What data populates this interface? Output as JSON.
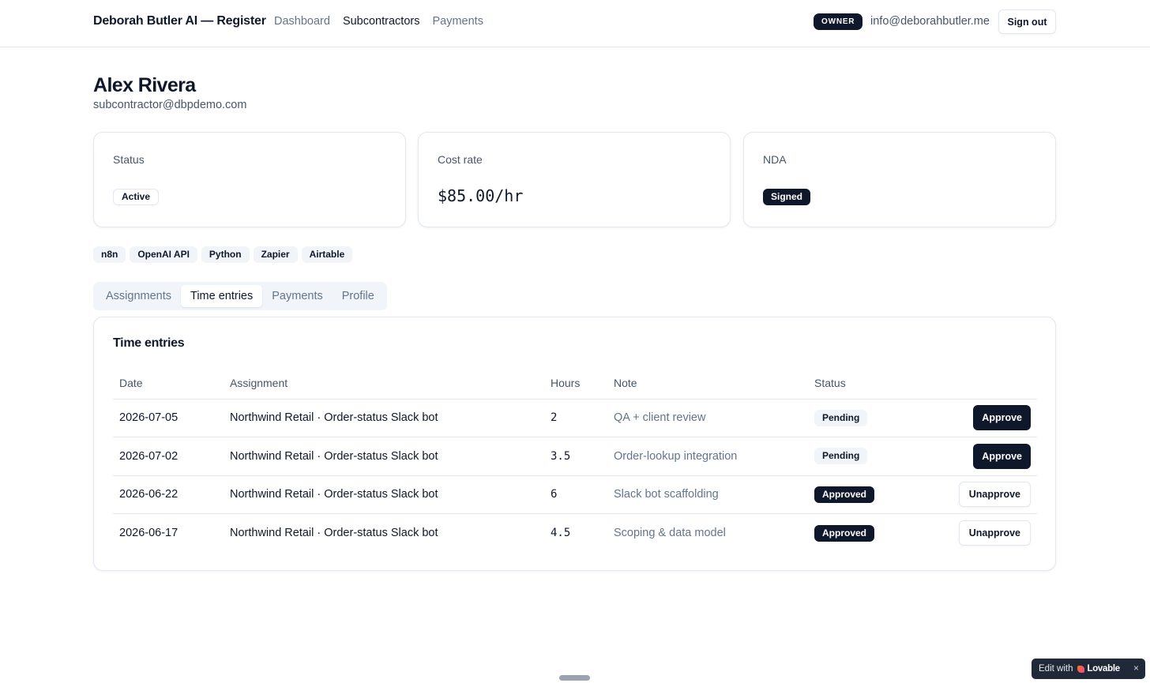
{
  "header": {
    "brand": "Deborah Butler AI — Register",
    "nav": [
      "Dashboard",
      "Subcontractors",
      "Payments"
    ],
    "active_nav": "Subcontractors",
    "role": "OWNER",
    "user_email": "info@deborahbutler.me",
    "signout_label": "Sign out"
  },
  "profile": {
    "name": "Alex Rivera",
    "email": "subcontractor@dbpdemo.com"
  },
  "cards": {
    "status": {
      "label": "Status",
      "value": "Active"
    },
    "rate": {
      "label": "Cost rate",
      "value": "$85.00/hr"
    },
    "nda": {
      "label": "NDA",
      "value": "Signed"
    }
  },
  "skills": [
    "n8n",
    "OpenAI API",
    "Python",
    "Zapier",
    "Airtable"
  ],
  "tabs": [
    "Assignments",
    "Time entries",
    "Payments",
    "Profile"
  ],
  "active_tab": "Time entries",
  "time_entries": {
    "title": "Time entries",
    "columns": [
      "Date",
      "Assignment",
      "Hours",
      "Note",
      "Status"
    ],
    "rows": [
      {
        "date": "2026-07-05",
        "assignment": "Northwind Retail · Order-status Slack bot",
        "hours": "2",
        "note": "QA + client review",
        "status": "Pending",
        "action": "Approve"
      },
      {
        "date": "2026-07-02",
        "assignment": "Northwind Retail · Order-status Slack bot",
        "hours": "3.5",
        "note": "Order-lookup integration",
        "status": "Pending",
        "action": "Approve"
      },
      {
        "date": "2026-06-22",
        "assignment": "Northwind Retail · Order-status Slack bot",
        "hours": "6",
        "note": "Slack bot scaffolding",
        "status": "Approved",
        "action": "Unapprove"
      },
      {
        "date": "2026-06-17",
        "assignment": "Northwind Retail · Order-status Slack bot",
        "hours": "4.5",
        "note": "Scoping & data model",
        "status": "Approved",
        "action": "Unapprove"
      }
    ]
  },
  "footer": {
    "edit_with": "Edit with",
    "lovable_brand": "Lovable",
    "close_glyph": "×"
  },
  "colors": {
    "primary": "#0f172a",
    "muted": "#64748b",
    "border": "#e2e8f0",
    "surface": "#f1f5f9"
  }
}
